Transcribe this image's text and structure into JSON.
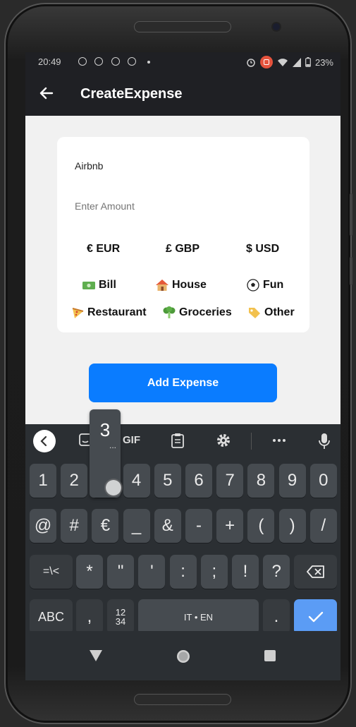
{
  "status_bar": {
    "time": "20:49",
    "battery": "23%"
  },
  "app_bar": {
    "title": "CreateExpense"
  },
  "form": {
    "description_value": "Airbnb",
    "amount_placeholder": "Enter Amount",
    "currencies": [
      "€ EUR",
      "£ GBP",
      "$ USD"
    ],
    "categories": [
      "Bill",
      "House",
      "Fun",
      "Restaurant",
      "Groceries",
      "Other"
    ],
    "submit_label": "Add Expense"
  },
  "keyboard": {
    "toolbar_gif": "GIF",
    "row1": [
      "1",
      "2",
      "3",
      "4",
      "5",
      "6",
      "7",
      "8",
      "9",
      "0"
    ],
    "row2": [
      "@",
      "#",
      "€",
      "_",
      "&",
      "-",
      "+",
      "(",
      ")",
      "/"
    ],
    "row3_left": "=\\<",
    "row3": [
      "*",
      "\"",
      "'",
      ":",
      ";",
      "!",
      "?"
    ],
    "abc": "ABC",
    "comma": ",",
    "numpad_top": "12",
    "numpad_bottom": "34",
    "space": "IT • EN",
    "period": ".",
    "popup_key": "3",
    "popup_dots": "..."
  },
  "colors": {
    "accent": "#0a7cff",
    "appbar": "#1f2024",
    "keyboard_bg": "#2b2f33",
    "enter_key": "#5b9cf5"
  }
}
